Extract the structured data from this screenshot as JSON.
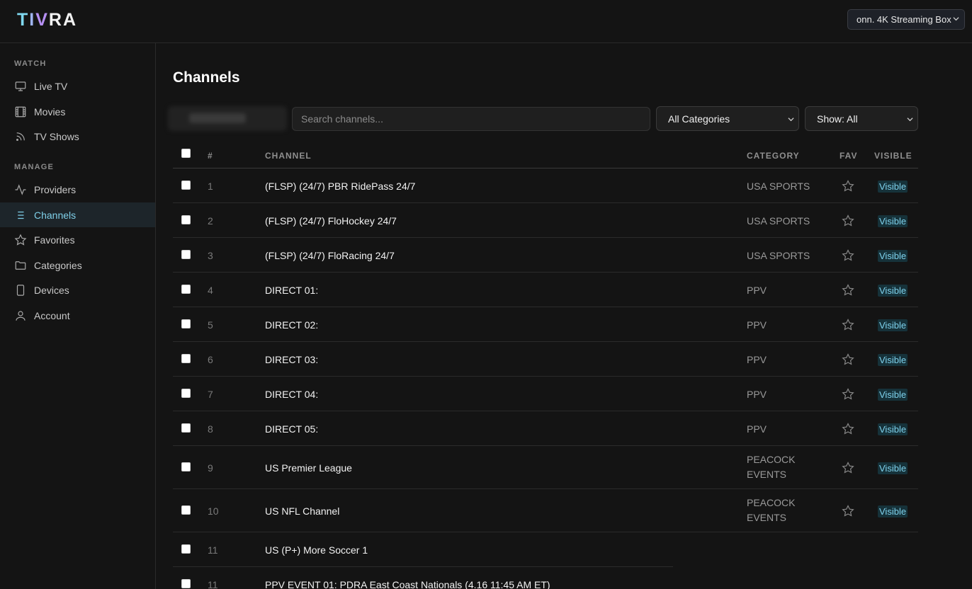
{
  "app": {
    "logo_letters": [
      "T",
      "I",
      "V",
      "RA"
    ],
    "device_selector": "onn. 4K Streaming Box"
  },
  "sidebar": {
    "sections": [
      {
        "label": "WATCH",
        "items": [
          {
            "label": "Live TV",
            "icon": "tv-icon"
          },
          {
            "label": "Movies",
            "icon": "film-icon"
          },
          {
            "label": "TV Shows",
            "icon": "rss-icon"
          }
        ]
      },
      {
        "label": "MANAGE",
        "items": [
          {
            "label": "Providers",
            "icon": "activity-icon"
          },
          {
            "label": "Channels",
            "icon": "list-icon",
            "active": true
          },
          {
            "label": "Favorites",
            "icon": "star-icon"
          },
          {
            "label": "Categories",
            "icon": "folder-icon"
          },
          {
            "label": "Devices",
            "icon": "phone-icon"
          },
          {
            "label": "Account",
            "icon": "user-icon"
          }
        ]
      }
    ]
  },
  "main": {
    "title": "Channels",
    "search_placeholder": "Search channels...",
    "category_filter": "All Categories",
    "show_filter": "Show: All",
    "columns": {
      "num": "#",
      "channel": "CHANNEL",
      "category": "CATEGORY",
      "fav": "FAV",
      "visible": "VISIBLE"
    },
    "rows": [
      {
        "num": "1",
        "name": "(FLSP) (24/7) PBR RidePass 24/7",
        "category": "USA SPORTS",
        "visible": "Visible"
      },
      {
        "num": "2",
        "name": "(FLSP) (24/7) FloHockey 24/7",
        "category": "USA SPORTS",
        "visible": "Visible"
      },
      {
        "num": "3",
        "name": "(FLSP) (24/7) FloRacing 24/7",
        "category": "USA SPORTS",
        "visible": "Visible"
      },
      {
        "num": "4",
        "name": "DIRECT 01:",
        "category": "PPV",
        "visible": "Visible"
      },
      {
        "num": "5",
        "name": "DIRECT 02:",
        "category": "PPV",
        "visible": "Visible"
      },
      {
        "num": "6",
        "name": "DIRECT 03:",
        "category": "PPV",
        "visible": "Visible"
      },
      {
        "num": "7",
        "name": "DIRECT 04:",
        "category": "PPV",
        "visible": "Visible"
      },
      {
        "num": "8",
        "name": "DIRECT 05:",
        "category": "PPV",
        "visible": "Visible"
      },
      {
        "num": "9",
        "name": "US Premier League",
        "category": "PEACOCK EVENTS",
        "visible": "Visible"
      },
      {
        "num": "10",
        "name": "US NFL Channel",
        "category": "PEACOCK EVENTS",
        "visible": "Visible"
      },
      {
        "num": "11",
        "name": "US (P+) More Soccer 1",
        "category": "",
        "visible": ""
      },
      {
        "num": "11",
        "name": "PPV EVENT 01: PDRA East Coast Nationals (4.16 11:45 AM ET)",
        "category": "",
        "visible": ""
      }
    ]
  },
  "colors": {
    "background": "#141414",
    "accent": "#7fd0e9",
    "active_nav_bg": "#1d252a",
    "visible_badge_bg": "#16323a"
  }
}
